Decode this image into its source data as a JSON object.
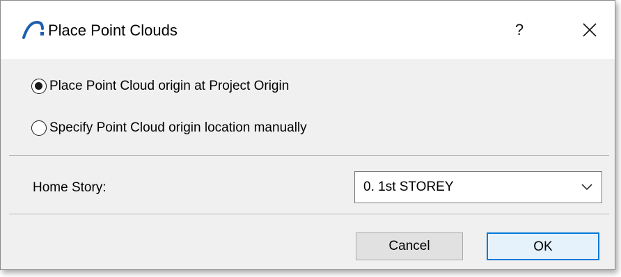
{
  "window": {
    "title": "Place Point Clouds",
    "help_label": "?",
    "close_icon": "close-icon",
    "app_icon": "archicad-arc-icon",
    "accent_color": "#0078d7",
    "app_icon_color": "#1f5fae"
  },
  "origin_options": [
    {
      "label": "Place Point Cloud origin at Project Origin",
      "checked": true
    },
    {
      "label": "Specify Point Cloud origin location manually",
      "checked": false
    }
  ],
  "home_story": {
    "label": "Home Story:",
    "selected": "0. 1st STOREY",
    "chevron_icon": "chevron-down-icon"
  },
  "buttons": {
    "cancel_label": "Cancel",
    "ok_label": "OK"
  }
}
